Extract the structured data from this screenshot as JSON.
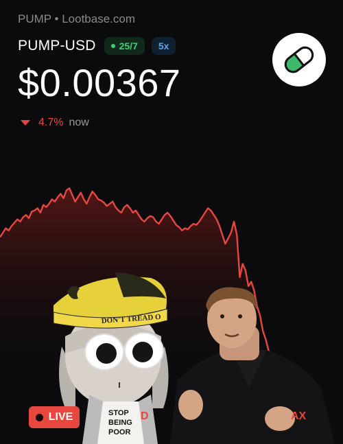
{
  "header": {
    "source": "PUMP • Lootbase.com",
    "pair": "PUMP-USD",
    "badge_hours": "25/7",
    "badge_leverage": "5x"
  },
  "price": {
    "value": "$0.00367",
    "change_pct": "4.7%",
    "change_period": "now",
    "direction": "down"
  },
  "colors": {
    "accent_down": "#e8473f",
    "accent_up": "#3fcf79",
    "background": "#0b0b0d"
  },
  "chart_data": {
    "type": "area",
    "values": [
      56,
      60,
      64,
      62,
      66,
      69,
      72,
      70,
      74,
      76,
      73,
      79,
      80,
      82,
      78,
      85,
      83,
      86,
      90,
      88,
      92,
      95,
      91,
      98,
      100,
      94,
      88,
      92,
      96,
      90,
      86,
      92,
      97,
      94,
      90,
      89,
      87,
      84,
      86,
      88,
      83,
      80,
      78,
      83,
      85,
      82,
      78,
      80,
      76,
      72,
      70,
      73,
      75,
      74,
      70,
      68,
      72,
      76,
      78,
      75,
      71,
      67,
      65,
      62,
      64,
      63,
      66,
      68,
      67,
      70,
      74,
      78,
      82,
      80,
      76,
      72,
      66,
      58,
      50,
      55,
      60,
      70,
      58,
      20,
      32,
      26,
      12,
      16,
      8,
      -6,
      -14,
      -28,
      -36,
      -46,
      -54,
      -60
    ],
    "ylim": [
      -70,
      110
    ]
  },
  "controls": {
    "live_label": "LIVE",
    "range_d": "D",
    "range_max": "AX"
  },
  "icons": {
    "pill": "pill-icon",
    "live": "record-dot-icon"
  }
}
